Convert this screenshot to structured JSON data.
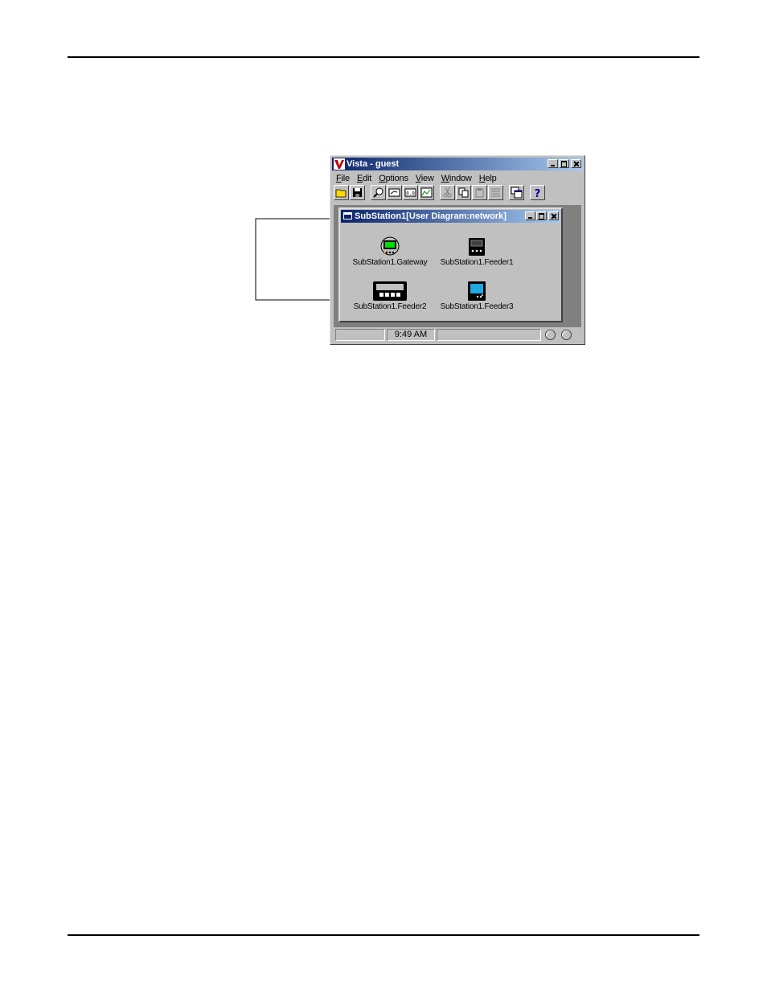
{
  "window": {
    "title": "Vista - guest",
    "menu": [
      "File",
      "Edit",
      "Options",
      "View",
      "Window",
      "Help"
    ],
    "toolbar": [
      "open-icon",
      "save-icon",
      "find-icon",
      "diagram-icon",
      "numeric-icon",
      "chart-icon",
      "cut-icon",
      "copy-icon",
      "paste-icon",
      "list-icon",
      "cascade-icon",
      "help-icon"
    ]
  },
  "diagram": {
    "title": "SubStation1[User Diagram:network]",
    "devices": [
      {
        "label": "SubStation1.Gateway",
        "icon": "gateway-icon"
      },
      {
        "label": "SubStation1.Feeder1",
        "icon": "meter-icon"
      },
      {
        "label": "SubStation1.Feeder2",
        "icon": "display-meter-icon"
      },
      {
        "label": "SubStation1.Feeder3",
        "icon": "meter-blue-icon"
      }
    ]
  },
  "statusbar": {
    "time": "9:49 AM"
  },
  "colors": {
    "titlebar_start": "#0a246a",
    "titlebar_end": "#a6caf0",
    "face": "#c0c0c0",
    "mdi_bg": "#808080"
  }
}
